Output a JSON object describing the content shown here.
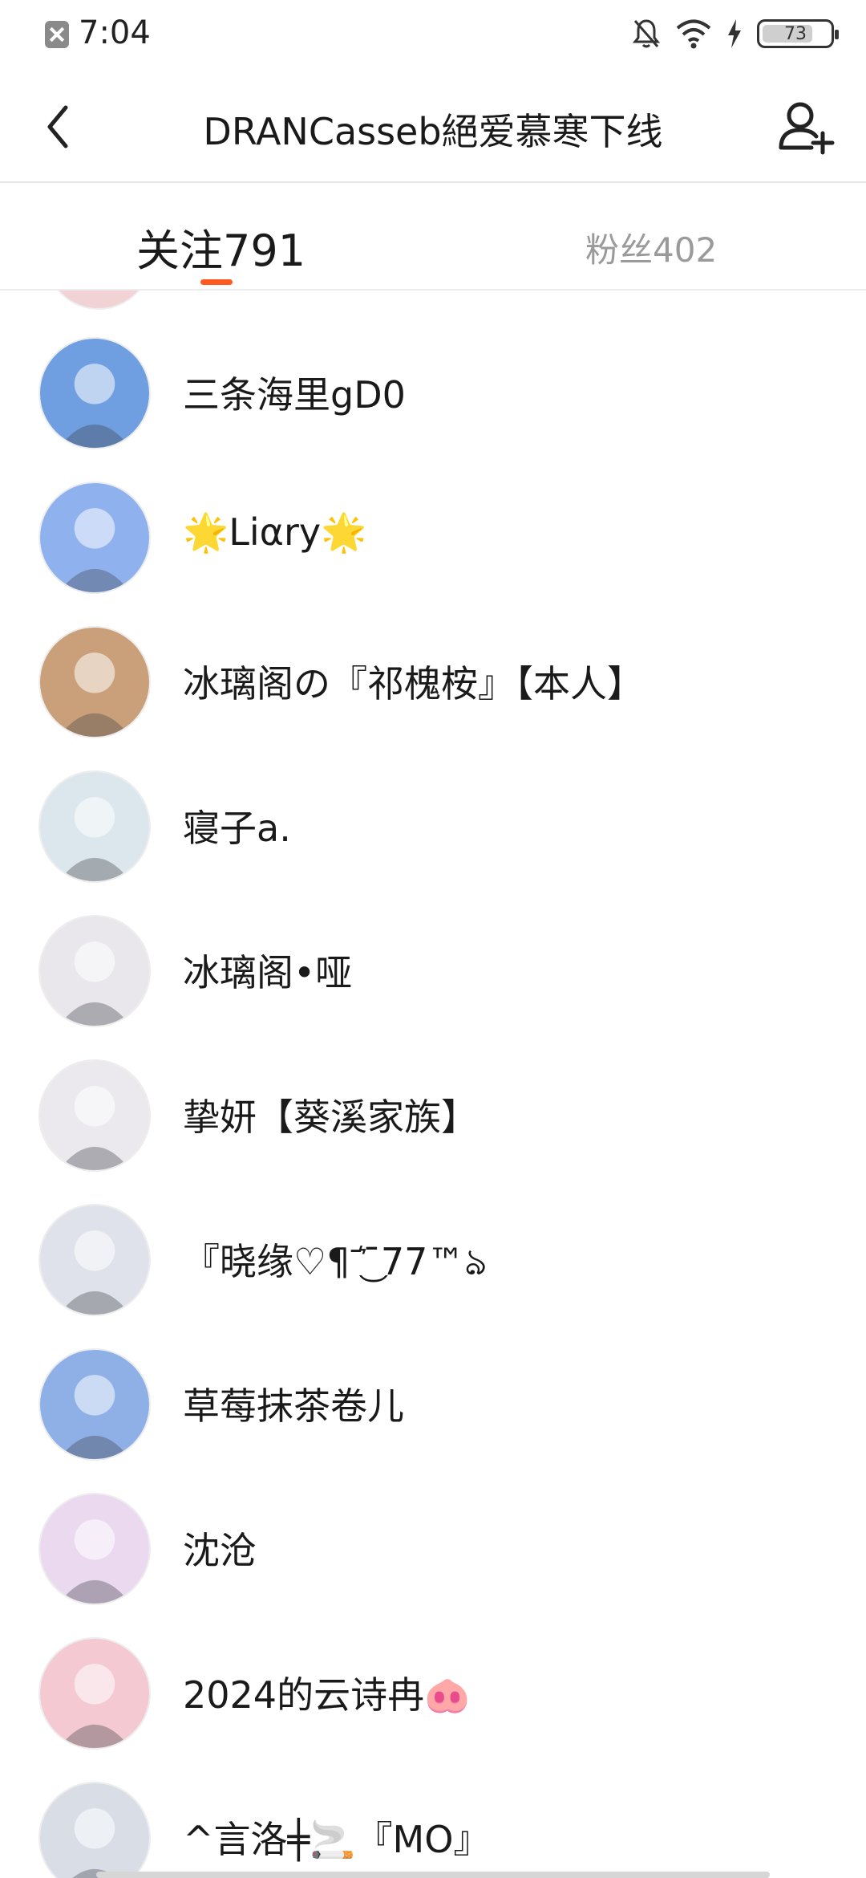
{
  "status_bar": {
    "time": "7:04",
    "battery": "73",
    "icons": [
      "notification-app-icon",
      "bell-off-icon",
      "wifi-icon",
      "charging-bolt-icon",
      "battery-icon"
    ]
  },
  "header": {
    "title": "DRANCasseb絕爱慕寒下线",
    "back_icon": "chevron-left-icon",
    "add_icon": "add-user-icon"
  },
  "tabs": {
    "following": "关注791",
    "fans": "粉丝402",
    "accent": "#ff5a1f"
  },
  "follow_list": [
    {
      "name": "三条海里gD0",
      "avatar_color": "#6f9fe0"
    },
    {
      "name": "🌟Liαry🌟",
      "avatar_color": "#8fb2ef"
    },
    {
      "name": "冰璃阁の『祁槐桉』【本人】",
      "avatar_color": "#c9a07a"
    },
    {
      "name": "寝子a.",
      "avatar_color": "#dbe7ec"
    },
    {
      "name": "冰璃阁•哑",
      "avatar_color": "#e9e6ec"
    },
    {
      "name": "挚妍【葵溪家族】",
      "avatar_color": "#ece9ee"
    },
    {
      "name": "『晓缘♡¶ˉ͛͜ˉ77™ঌ",
      "avatar_color": "#dfe2ea"
    },
    {
      "name": "草莓抹茶卷儿",
      "avatar_color": "#8fb0e6"
    },
    {
      "name": "沈沧",
      "avatar_color": "#ead9ef"
    },
    {
      "name": "2024的云诗冉🐽",
      "avatar_color": "#f4c9d2"
    },
    {
      "name": "^言洛╪🚬『MO』",
      "avatar_color": "#d8dde6"
    }
  ]
}
